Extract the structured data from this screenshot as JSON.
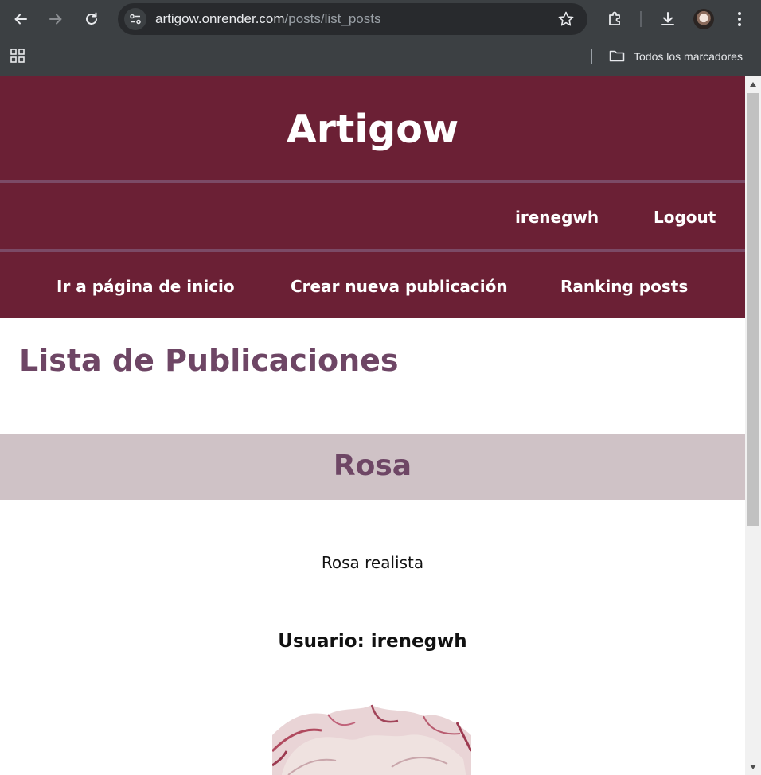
{
  "browser": {
    "url_domain": "artigow.onrender.com",
    "url_path": "/posts/list_posts",
    "bookmarks_label": "Todos los marcadores"
  },
  "site": {
    "title": "Artigow",
    "user_nav": {
      "username": "irenegwh",
      "logout": "Logout"
    },
    "menu": {
      "home": "Ir a página de inicio",
      "new_post": "Crear nueva publicación",
      "ranking": "Ranking posts"
    }
  },
  "main": {
    "heading": "Lista de Publicaciones",
    "posts": [
      {
        "title": "Rosa",
        "description": "Rosa realista",
        "user": "Usuario: irenegwh"
      }
    ]
  },
  "colors": {
    "header_bg": "#6b2035",
    "accent": "#6e4665",
    "post_bar": "#cfc2c6"
  }
}
